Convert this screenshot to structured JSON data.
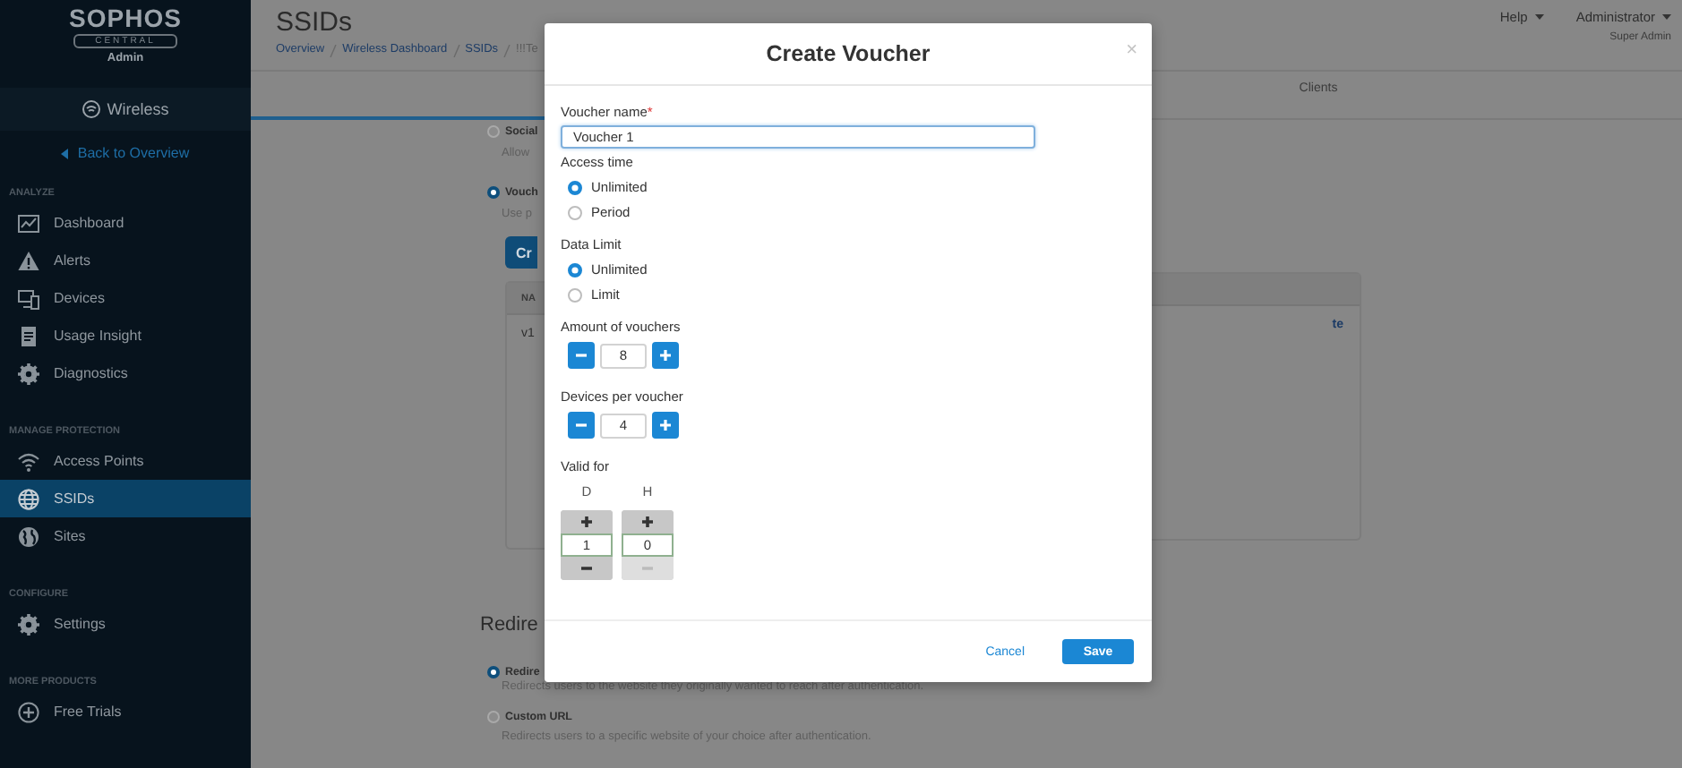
{
  "sidebar": {
    "logo": "SOPHOS",
    "product": "CENTRAL",
    "role": "Admin",
    "section_title": "Wireless",
    "back_link": "Back to Overview",
    "groups": [
      {
        "heading": "ANALYZE",
        "items": [
          {
            "label": "Dashboard",
            "kind": "chart",
            "selected": false
          },
          {
            "label": "Alerts",
            "kind": "alert",
            "selected": false
          },
          {
            "label": "Devices",
            "kind": "devices",
            "selected": false
          },
          {
            "label": "Usage Insight",
            "kind": "report",
            "selected": false
          },
          {
            "label": "Diagnostics",
            "kind": "gear",
            "selected": false
          }
        ]
      },
      {
        "heading": "MANAGE PROTECTION",
        "items": [
          {
            "label": "Access Points",
            "kind": "wifi",
            "selected": false
          },
          {
            "label": "SSIDs",
            "kind": "globe",
            "selected": true
          },
          {
            "label": "Sites",
            "kind": "earth",
            "selected": false
          }
        ]
      },
      {
        "heading": "CONFIGURE",
        "items": [
          {
            "label": "Settings",
            "kind": "gear",
            "selected": false
          }
        ]
      },
      {
        "heading": "MORE PRODUCTS",
        "items": [
          {
            "label": "Free Trials",
            "kind": "plus",
            "selected": false
          }
        ]
      }
    ]
  },
  "header": {
    "title": "SSIDs",
    "breadcrumb": [
      "Overview",
      "Wireless Dashboard",
      "SSIDs",
      "!!!Te"
    ],
    "help_menu": "Help",
    "user_menu": "Administrator",
    "user_role": "Super Admin"
  },
  "tabs": [
    {
      "label": "Clients",
      "selected": false
    }
  ],
  "login_options": [
    {
      "label": "Social",
      "description": "Allow",
      "selected": false
    },
    {
      "label": "Vouch",
      "description": "Use p",
      "selected": true
    }
  ],
  "create_button": "Cr",
  "voucher_table": {
    "column_1": "NA",
    "rows": [
      {
        "name": "v1",
        "action": "te"
      }
    ]
  },
  "redirect": {
    "heading": "Redire",
    "options": [
      {
        "label": "Redire",
        "description": "Redirects users to the website they originally wanted to reach after authentication.",
        "selected": true
      },
      {
        "label": "Custom URL",
        "description": "Redirects users to a specific website of your choice after authentication.",
        "selected": false
      }
    ]
  },
  "dialog": {
    "title": "Create Voucher",
    "close": "×",
    "name_field": {
      "label": "Voucher name",
      "required_mark": "*",
      "value": "Voucher 1"
    },
    "radio_groups": [
      {
        "label": "Access time",
        "options": [
          {
            "label": "Unlimited",
            "selected": true
          },
          {
            "label": "Period",
            "selected": false
          }
        ]
      },
      {
        "label": "Data Limit",
        "options": [
          {
            "label": "Unlimited",
            "selected": true
          },
          {
            "label": "Limit",
            "selected": false
          }
        ]
      }
    ],
    "steppers": [
      {
        "label": "Amount of vouchers",
        "value": "8"
      },
      {
        "label": "Devices per voucher",
        "value": "4"
      }
    ],
    "valid_for": {
      "label": "Valid for",
      "units": [
        {
          "label": "D",
          "value": "1",
          "decrement_disabled": false
        },
        {
          "label": "H",
          "value": "0",
          "decrement_disabled": true
        }
      ]
    },
    "cancel": "Cancel",
    "save": "Save"
  }
}
